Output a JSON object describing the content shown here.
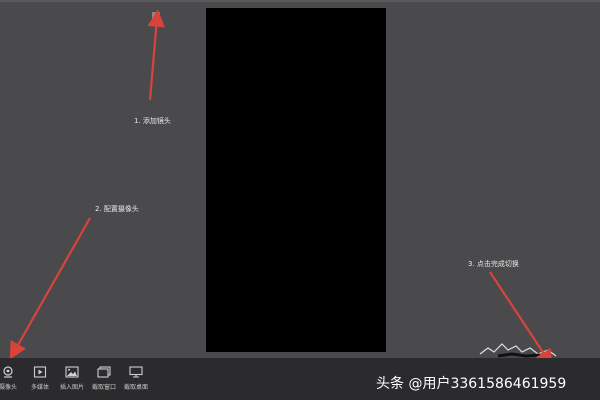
{
  "annotations": {
    "step1": "1. 添加镜头",
    "step2": "2. 配置摄像头",
    "step3": "3. 点击完成切换"
  },
  "toolbar": {
    "items": [
      {
        "label": "摄像头",
        "icon": "camera-icon"
      },
      {
        "label": "多媒体",
        "icon": "media-play-icon"
      },
      {
        "label": "插入图片",
        "icon": "image-icon"
      },
      {
        "label": "截取窗口",
        "icon": "window-capture-icon"
      },
      {
        "label": "截取桌面",
        "icon": "monitor-icon"
      }
    ]
  },
  "watermark": "头条 @用户3361586461959",
  "colors": {
    "background": "#4a494b",
    "preview": "#000000",
    "toolbar": "#2b2a2c",
    "arrow": "#d8443c"
  }
}
